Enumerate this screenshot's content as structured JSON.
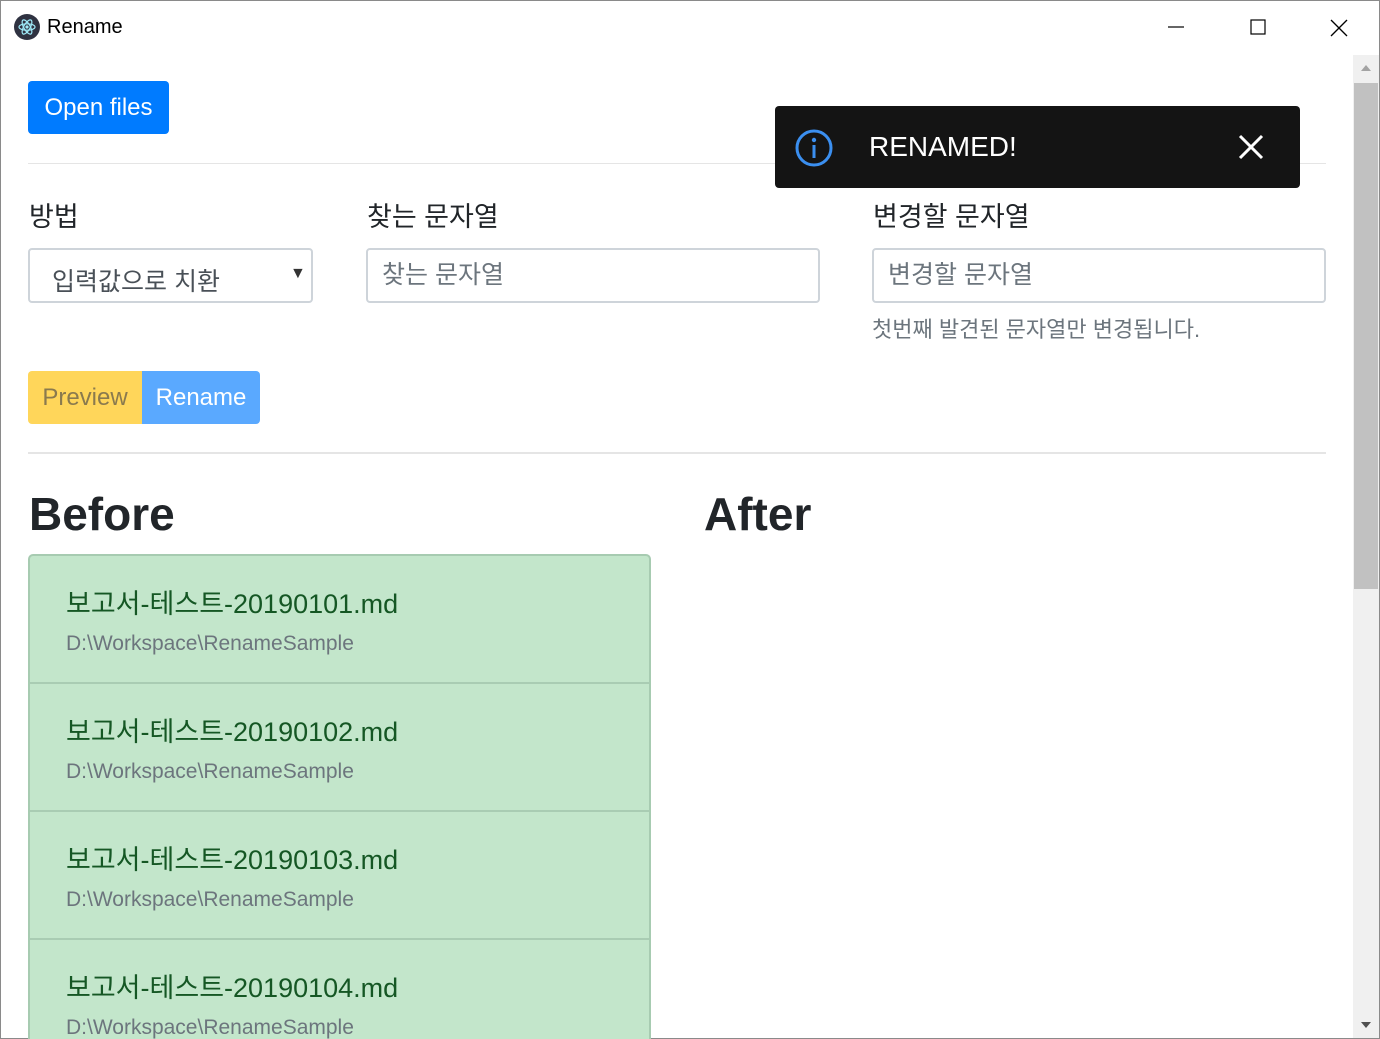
{
  "window": {
    "title": "Rename",
    "icon": "electron-logo-icon"
  },
  "toolbar": {
    "open_files_label": "Open files"
  },
  "form": {
    "method_label": "방법",
    "method_value": "입력값으로 치환",
    "find_label": "찾는 문자열",
    "find_placeholder": "찾는 문자열",
    "find_value": "",
    "replace_label": "변경할 문자열",
    "replace_placeholder": "변경할 문자열",
    "replace_value": "",
    "replace_help": "첫번째 발견된 문자열만 변경됩니다."
  },
  "actions": {
    "preview_label": "Preview",
    "rename_label": "Rename"
  },
  "before": {
    "heading": "Before",
    "files": [
      {
        "name": "보고서-테스트-20190101.md",
        "path": "D:\\Workspace\\RenameSample"
      },
      {
        "name": "보고서-테스트-20190102.md",
        "path": "D:\\Workspace\\RenameSample"
      },
      {
        "name": "보고서-테스트-20190103.md",
        "path": "D:\\Workspace\\RenameSample"
      },
      {
        "name": "보고서-테스트-20190104.md",
        "path": "D:\\Workspace\\RenameSample"
      }
    ]
  },
  "after": {
    "heading": "After",
    "files": []
  },
  "toast": {
    "message": "RENAMED!",
    "icon": "info-icon",
    "close_icon": "close-icon"
  },
  "colors": {
    "primary": "#007bff",
    "warning": "#ffd65a",
    "rename_button": "#5aa9ff",
    "success_bg": "#c3e6cb",
    "success_text": "#155724",
    "toast_bg": "#141414",
    "toast_icon": "#3b8ff0"
  }
}
